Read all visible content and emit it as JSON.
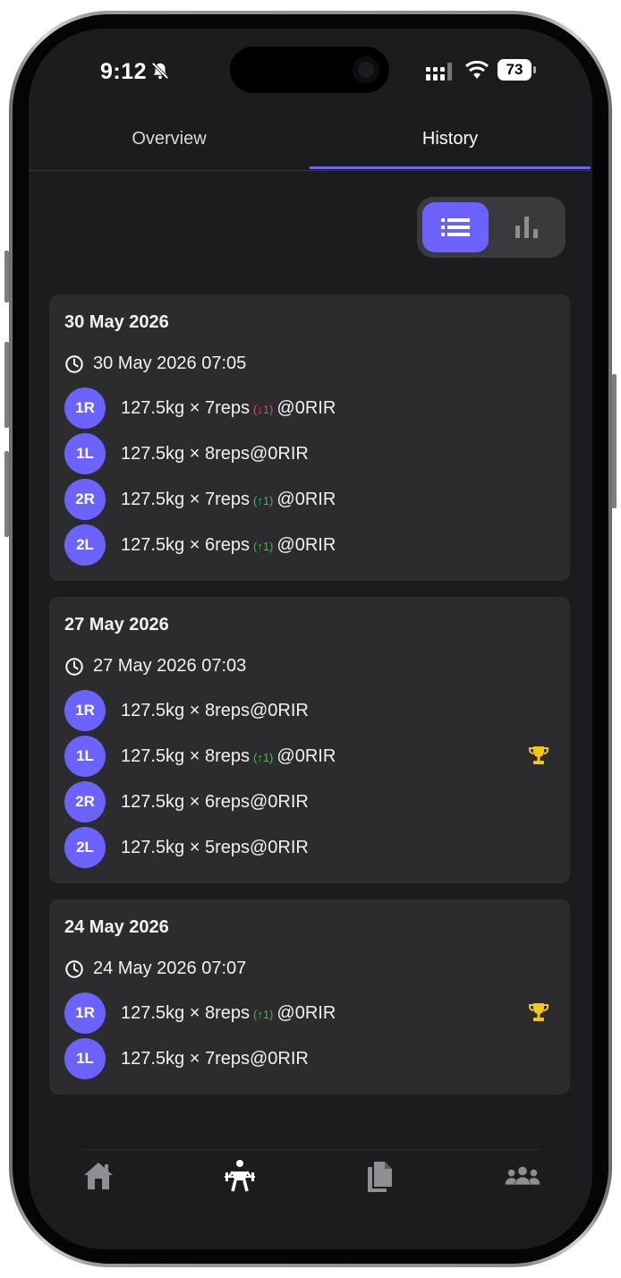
{
  "status_bar": {
    "time": "9:12",
    "battery": "73",
    "icons": [
      "bell-slash-icon",
      "signal-icon",
      "wifi-icon",
      "battery-icon"
    ]
  },
  "tabs": [
    {
      "label": "Overview",
      "active": false
    },
    {
      "label": "History",
      "active": true
    }
  ],
  "view_toggle": {
    "options": [
      "list-icon",
      "bar-chart-icon"
    ],
    "active": "list-icon"
  },
  "accent_color": "#6c63ff",
  "sessions": [
    {
      "date": "30 May 2026",
      "timestamp": "30 May 2026 07:05",
      "sets": [
        {
          "badge": "1R",
          "weight_reps": "127.5kg × 7reps",
          "change": "(↓1)",
          "dir": "down",
          "rir": "@0RIR",
          "trophy": false
        },
        {
          "badge": "1L",
          "weight_reps": "127.5kg × 8reps",
          "change": "",
          "dir": "",
          "rir": "@0RIR",
          "trophy": false
        },
        {
          "badge": "2R",
          "weight_reps": "127.5kg × 7reps",
          "change": "(↑1)",
          "dir": "up",
          "rir": "@0RIR",
          "trophy": false
        },
        {
          "badge": "2L",
          "weight_reps": "127.5kg × 6reps",
          "change": "(↑1)",
          "dir": "up",
          "rir": "@0RIR",
          "trophy": false
        }
      ]
    },
    {
      "date": "27 May 2026",
      "timestamp": "27 May 2026 07:03",
      "sets": [
        {
          "badge": "1R",
          "weight_reps": "127.5kg × 8reps",
          "change": "",
          "dir": "",
          "rir": "@0RIR",
          "trophy": false
        },
        {
          "badge": "1L",
          "weight_reps": "127.5kg × 8reps",
          "change": "(↑1)",
          "dir": "up",
          "rir": "@0RIR",
          "trophy": true
        },
        {
          "badge": "2R",
          "weight_reps": "127.5kg × 6reps",
          "change": "",
          "dir": "",
          "rir": "@0RIR",
          "trophy": false
        },
        {
          "badge": "2L",
          "weight_reps": "127.5kg × 5reps",
          "change": "",
          "dir": "",
          "rir": "@0RIR",
          "trophy": false
        }
      ]
    },
    {
      "date": "24 May 2026",
      "timestamp": "24 May 2026 07:07",
      "sets": [
        {
          "badge": "1R",
          "weight_reps": "127.5kg × 8reps",
          "change": "(↑1)",
          "dir": "up",
          "rir": "@0RIR",
          "trophy": true
        },
        {
          "badge": "1L",
          "weight_reps": "127.5kg × 7reps",
          "change": "",
          "dir": "",
          "rir": "@0RIR",
          "trophy": false
        }
      ]
    }
  ],
  "bottom_nav": [
    {
      "icon": "home-icon",
      "active": false
    },
    {
      "icon": "weightlifter-icon",
      "active": true
    },
    {
      "icon": "documents-icon",
      "active": false
    },
    {
      "icon": "users-icon",
      "active": false
    }
  ]
}
